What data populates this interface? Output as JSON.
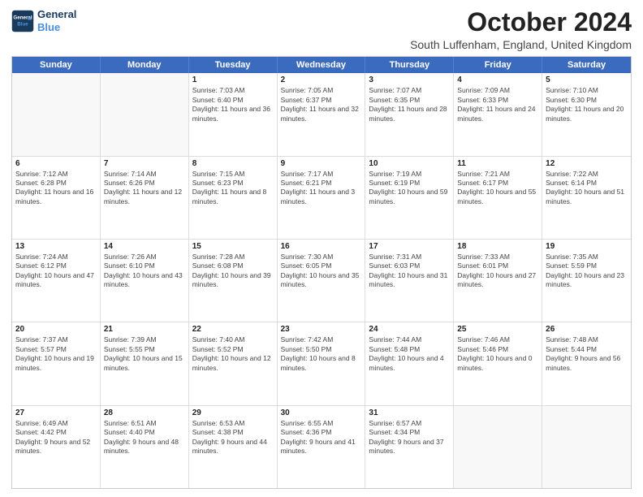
{
  "header": {
    "logo_line1": "General",
    "logo_line2": "Blue",
    "month": "October 2024",
    "location": "South Luffenham, England, United Kingdom"
  },
  "weekdays": [
    "Sunday",
    "Monday",
    "Tuesday",
    "Wednesday",
    "Thursday",
    "Friday",
    "Saturday"
  ],
  "rows": [
    [
      {
        "day": "",
        "sunrise": "",
        "sunset": "",
        "daylight": ""
      },
      {
        "day": "",
        "sunrise": "",
        "sunset": "",
        "daylight": ""
      },
      {
        "day": "1",
        "sunrise": "Sunrise: 7:03 AM",
        "sunset": "Sunset: 6:40 PM",
        "daylight": "Daylight: 11 hours and 36 minutes."
      },
      {
        "day": "2",
        "sunrise": "Sunrise: 7:05 AM",
        "sunset": "Sunset: 6:37 PM",
        "daylight": "Daylight: 11 hours and 32 minutes."
      },
      {
        "day": "3",
        "sunrise": "Sunrise: 7:07 AM",
        "sunset": "Sunset: 6:35 PM",
        "daylight": "Daylight: 11 hours and 28 minutes."
      },
      {
        "day": "4",
        "sunrise": "Sunrise: 7:09 AM",
        "sunset": "Sunset: 6:33 PM",
        "daylight": "Daylight: 11 hours and 24 minutes."
      },
      {
        "day": "5",
        "sunrise": "Sunrise: 7:10 AM",
        "sunset": "Sunset: 6:30 PM",
        "daylight": "Daylight: 11 hours and 20 minutes."
      }
    ],
    [
      {
        "day": "6",
        "sunrise": "Sunrise: 7:12 AM",
        "sunset": "Sunset: 6:28 PM",
        "daylight": "Daylight: 11 hours and 16 minutes."
      },
      {
        "day": "7",
        "sunrise": "Sunrise: 7:14 AM",
        "sunset": "Sunset: 6:26 PM",
        "daylight": "Daylight: 11 hours and 12 minutes."
      },
      {
        "day": "8",
        "sunrise": "Sunrise: 7:15 AM",
        "sunset": "Sunset: 6:23 PM",
        "daylight": "Daylight: 11 hours and 8 minutes."
      },
      {
        "day": "9",
        "sunrise": "Sunrise: 7:17 AM",
        "sunset": "Sunset: 6:21 PM",
        "daylight": "Daylight: 11 hours and 3 minutes."
      },
      {
        "day": "10",
        "sunrise": "Sunrise: 7:19 AM",
        "sunset": "Sunset: 6:19 PM",
        "daylight": "Daylight: 10 hours and 59 minutes."
      },
      {
        "day": "11",
        "sunrise": "Sunrise: 7:21 AM",
        "sunset": "Sunset: 6:17 PM",
        "daylight": "Daylight: 10 hours and 55 minutes."
      },
      {
        "day": "12",
        "sunrise": "Sunrise: 7:22 AM",
        "sunset": "Sunset: 6:14 PM",
        "daylight": "Daylight: 10 hours and 51 minutes."
      }
    ],
    [
      {
        "day": "13",
        "sunrise": "Sunrise: 7:24 AM",
        "sunset": "Sunset: 6:12 PM",
        "daylight": "Daylight: 10 hours and 47 minutes."
      },
      {
        "day": "14",
        "sunrise": "Sunrise: 7:26 AM",
        "sunset": "Sunset: 6:10 PM",
        "daylight": "Daylight: 10 hours and 43 minutes."
      },
      {
        "day": "15",
        "sunrise": "Sunrise: 7:28 AM",
        "sunset": "Sunset: 6:08 PM",
        "daylight": "Daylight: 10 hours and 39 minutes."
      },
      {
        "day": "16",
        "sunrise": "Sunrise: 7:30 AM",
        "sunset": "Sunset: 6:05 PM",
        "daylight": "Daylight: 10 hours and 35 minutes."
      },
      {
        "day": "17",
        "sunrise": "Sunrise: 7:31 AM",
        "sunset": "Sunset: 6:03 PM",
        "daylight": "Daylight: 10 hours and 31 minutes."
      },
      {
        "day": "18",
        "sunrise": "Sunrise: 7:33 AM",
        "sunset": "Sunset: 6:01 PM",
        "daylight": "Daylight: 10 hours and 27 minutes."
      },
      {
        "day": "19",
        "sunrise": "Sunrise: 7:35 AM",
        "sunset": "Sunset: 5:59 PM",
        "daylight": "Daylight: 10 hours and 23 minutes."
      }
    ],
    [
      {
        "day": "20",
        "sunrise": "Sunrise: 7:37 AM",
        "sunset": "Sunset: 5:57 PM",
        "daylight": "Daylight: 10 hours and 19 minutes."
      },
      {
        "day": "21",
        "sunrise": "Sunrise: 7:39 AM",
        "sunset": "Sunset: 5:55 PM",
        "daylight": "Daylight: 10 hours and 15 minutes."
      },
      {
        "day": "22",
        "sunrise": "Sunrise: 7:40 AM",
        "sunset": "Sunset: 5:52 PM",
        "daylight": "Daylight: 10 hours and 12 minutes."
      },
      {
        "day": "23",
        "sunrise": "Sunrise: 7:42 AM",
        "sunset": "Sunset: 5:50 PM",
        "daylight": "Daylight: 10 hours and 8 minutes."
      },
      {
        "day": "24",
        "sunrise": "Sunrise: 7:44 AM",
        "sunset": "Sunset: 5:48 PM",
        "daylight": "Daylight: 10 hours and 4 minutes."
      },
      {
        "day": "25",
        "sunrise": "Sunrise: 7:46 AM",
        "sunset": "Sunset: 5:46 PM",
        "daylight": "Daylight: 10 hours and 0 minutes."
      },
      {
        "day": "26",
        "sunrise": "Sunrise: 7:48 AM",
        "sunset": "Sunset: 5:44 PM",
        "daylight": "Daylight: 9 hours and 56 minutes."
      }
    ],
    [
      {
        "day": "27",
        "sunrise": "Sunrise: 6:49 AM",
        "sunset": "Sunset: 4:42 PM",
        "daylight": "Daylight: 9 hours and 52 minutes."
      },
      {
        "day": "28",
        "sunrise": "Sunrise: 6:51 AM",
        "sunset": "Sunset: 4:40 PM",
        "daylight": "Daylight: 9 hours and 48 minutes."
      },
      {
        "day": "29",
        "sunrise": "Sunrise: 6:53 AM",
        "sunset": "Sunset: 4:38 PM",
        "daylight": "Daylight: 9 hours and 44 minutes."
      },
      {
        "day": "30",
        "sunrise": "Sunrise: 6:55 AM",
        "sunset": "Sunset: 4:36 PM",
        "daylight": "Daylight: 9 hours and 41 minutes."
      },
      {
        "day": "31",
        "sunrise": "Sunrise: 6:57 AM",
        "sunset": "Sunset: 4:34 PM",
        "daylight": "Daylight: 9 hours and 37 minutes."
      },
      {
        "day": "",
        "sunrise": "",
        "sunset": "",
        "daylight": ""
      },
      {
        "day": "",
        "sunrise": "",
        "sunset": "",
        "daylight": ""
      }
    ]
  ]
}
